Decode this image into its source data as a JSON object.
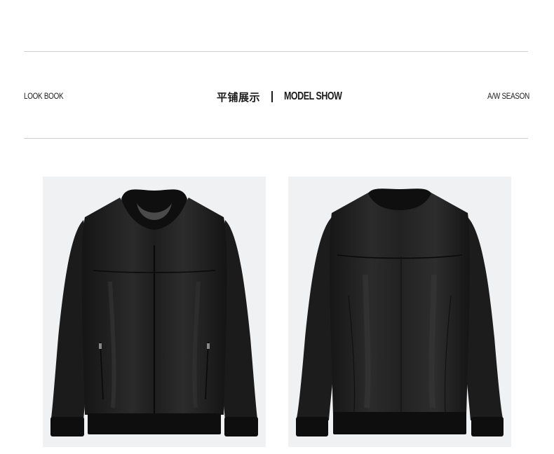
{
  "header": {
    "left_label": "LOOK BOOK",
    "title_cn": "平铺展示",
    "title_en": "MODEL SHOW",
    "right_label": "A/W SEASON"
  },
  "gallery": {
    "items": [
      {
        "view": "front",
        "subject": "black leather bomber jacket"
      },
      {
        "view": "back",
        "subject": "black leather bomber jacket"
      }
    ]
  },
  "colors": {
    "divider": "#cfcfcf",
    "text": "#1a1a1a",
    "photo_background": "#f0f1f3",
    "leather": "#1c1c1c"
  }
}
